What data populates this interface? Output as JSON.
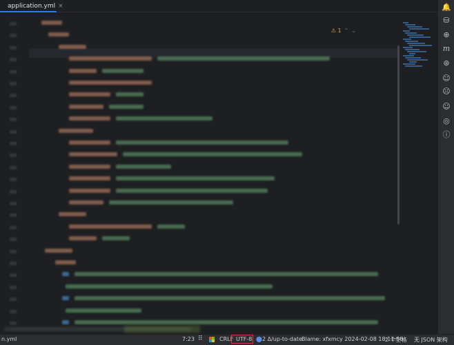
{
  "tab": {
    "filename": "application.yml",
    "close_glyph": "×"
  },
  "inspection": {
    "warnings": "⚠ 1",
    "up": "⌃",
    "down": "⌄"
  },
  "status": {
    "file": "n.yml",
    "position": "7:23",
    "line_separator": "CRLF",
    "encoding": "UTF-8",
    "vcs": "2 Δ/up-to-date",
    "blame": "Blame: xfxmcy 2024-02-08 18:11:58",
    "indent": "2 个空格",
    "schema": "无 JSON 架构"
  },
  "colors": {
    "accent": "#3574f0",
    "highlight_box": "#e23a3a",
    "key": "#cf8e6d",
    "value": "#6aab73",
    "keyword": "#56a8f5"
  },
  "right_icons": [
    "bell-icon",
    "database-icon",
    "grid-icon",
    "maven-icon",
    "copilot-icon",
    "robot-icon",
    "face-icon",
    "globe-icon",
    "info-icon"
  ]
}
